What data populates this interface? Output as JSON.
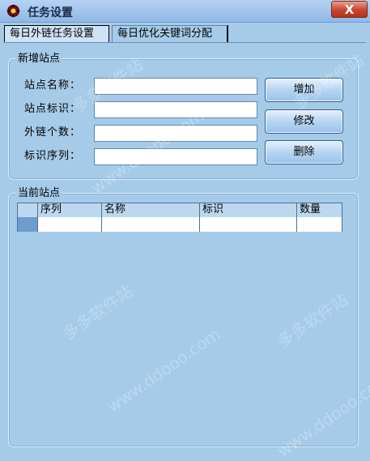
{
  "window": {
    "title": "任务设置",
    "close_label": "X"
  },
  "tabs": [
    {
      "label": "每日外链任务设置",
      "active": true
    },
    {
      "label": "每日优化关键词分配",
      "active": false
    }
  ],
  "new_site": {
    "legend": "新增站点",
    "fields": [
      {
        "label": "站点名称：",
        "value": ""
      },
      {
        "label": "站点标识：",
        "value": ""
      },
      {
        "label": "外链个数：",
        "value": ""
      },
      {
        "label": "标识序列：",
        "value": ""
      }
    ],
    "buttons": {
      "add": "增加",
      "edit": "修改",
      "delete": "删除"
    }
  },
  "current_sites": {
    "legend": "当前站点",
    "columns": [
      "序列",
      "名称",
      "标识",
      "数量"
    ],
    "rows": [
      [
        "",
        "",
        "",
        ""
      ]
    ]
  },
  "watermark": {
    "text_cn": "多多软件站",
    "text_url": "www.ddooo.com"
  },
  "colors": {
    "background": "#a6cbe9",
    "close_button": "#c8452c",
    "border": "#4d6f96"
  }
}
